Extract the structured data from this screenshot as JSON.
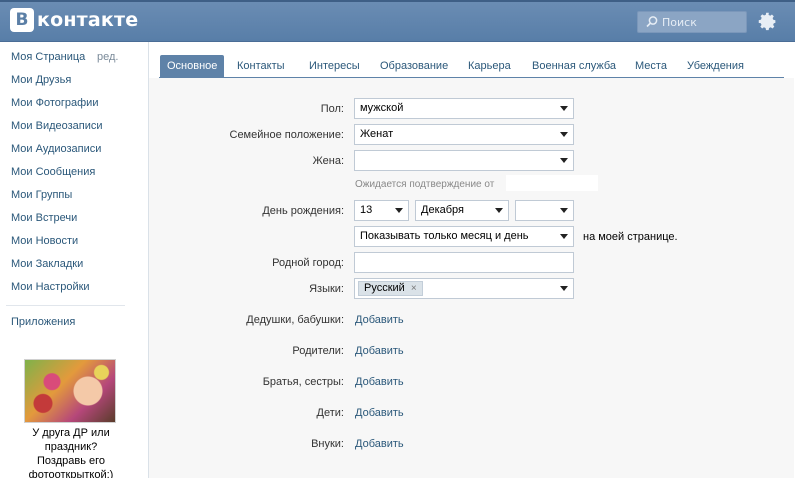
{
  "header": {
    "logo_letter": "B",
    "logo_text": "контакте",
    "search_placeholder": "Поиск",
    "brand_color": "#5b7fa6"
  },
  "left_menu": {
    "items": [
      {
        "label": "Моя Страница",
        "edit": "ред."
      },
      {
        "label": "Мои Друзья"
      },
      {
        "label": "Мои Фотографии"
      },
      {
        "label": "Мои Видеозаписи"
      },
      {
        "label": "Мои Аудиозаписи"
      },
      {
        "label": "Мои Сообщения"
      },
      {
        "label": "Мои Группы"
      },
      {
        "label": "Мои Встречи"
      },
      {
        "label": "Мои Новости"
      },
      {
        "label": "Мои Закладки"
      },
      {
        "label": "Мои Настройки"
      }
    ],
    "apps": "Приложения",
    "ad_text": [
      "У друга ДР или",
      "праздник?",
      "Поздравь его",
      "фотооткрыткой;)"
    ]
  },
  "tabs": [
    {
      "label": "Основное",
      "active": true
    },
    {
      "label": "Контакты"
    },
    {
      "label": "Интересы"
    },
    {
      "label": "Образование"
    },
    {
      "label": "Карьера"
    },
    {
      "label": "Военная служба"
    },
    {
      "label": "Места"
    },
    {
      "label": "Убеждения"
    }
  ],
  "form": {
    "gender": {
      "label": "Пол:",
      "value": "мужской"
    },
    "marital": {
      "label": "Семейное положение:",
      "value": "Женат"
    },
    "spouse": {
      "label": "Жена:",
      "value": "",
      "note": "Ожидается подтверждение от"
    },
    "birthday": {
      "label": "День рождения:",
      "day": "13",
      "month": "Декабря",
      "year": "",
      "visibility": "Показывать только месяц и день",
      "suffix": "на моей странице."
    },
    "hometown": {
      "label": "Родной город:",
      "value": ""
    },
    "languages": {
      "label": "Языки:",
      "tag": "Русский",
      "remove": "×"
    },
    "grandparents": {
      "label": "Дедушки, бабушки:",
      "action": "Добавить"
    },
    "parents": {
      "label": "Родители:",
      "action": "Добавить"
    },
    "siblings": {
      "label": "Братья, сестры:",
      "action": "Добавить"
    },
    "children": {
      "label": "Дети:",
      "action": "Добавить"
    },
    "grandchildren": {
      "label": "Внуки:",
      "action": "Добавить"
    }
  }
}
